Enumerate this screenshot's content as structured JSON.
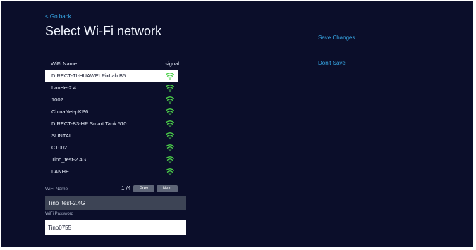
{
  "nav": {
    "back_label": "< Go back"
  },
  "page": {
    "title": "Select Wi-Fi network"
  },
  "list": {
    "header_name": "WiFi Name",
    "header_signal": "signal",
    "items": [
      {
        "name": "DIRECT-TI-HUAWEI PixLab B5",
        "selected": true
      },
      {
        "name": "LanHe-2.4"
      },
      {
        "name": "1002"
      },
      {
        "name": "ChinaNet-pKP6"
      },
      {
        "name": "DIRECT-B3-HP Smart Tank 510"
      },
      {
        "name": "SUNTAL"
      },
      {
        "name": "C1002"
      },
      {
        "name": "Tino_test-2.4G"
      },
      {
        "name": "LANHE"
      }
    ]
  },
  "pager": {
    "field_label": "WiFi Name",
    "page_indicator": "1 /4",
    "prev_label": "Prev",
    "next_label": "Next"
  },
  "form": {
    "wifi_name_value": "Tino_test-2.4G",
    "password_label": "WiFi Password",
    "password_value": "Tino0755"
  },
  "actions": {
    "save_label": "Save Changes",
    "dont_save_label": "Don't Save"
  },
  "colors": {
    "background": "#0b0e2a",
    "accent": "#37a9e8",
    "signal": "#4ccf4a",
    "selected_row": "#ffffff"
  },
  "icons": {
    "signal": "wifi-signal-icon"
  }
}
